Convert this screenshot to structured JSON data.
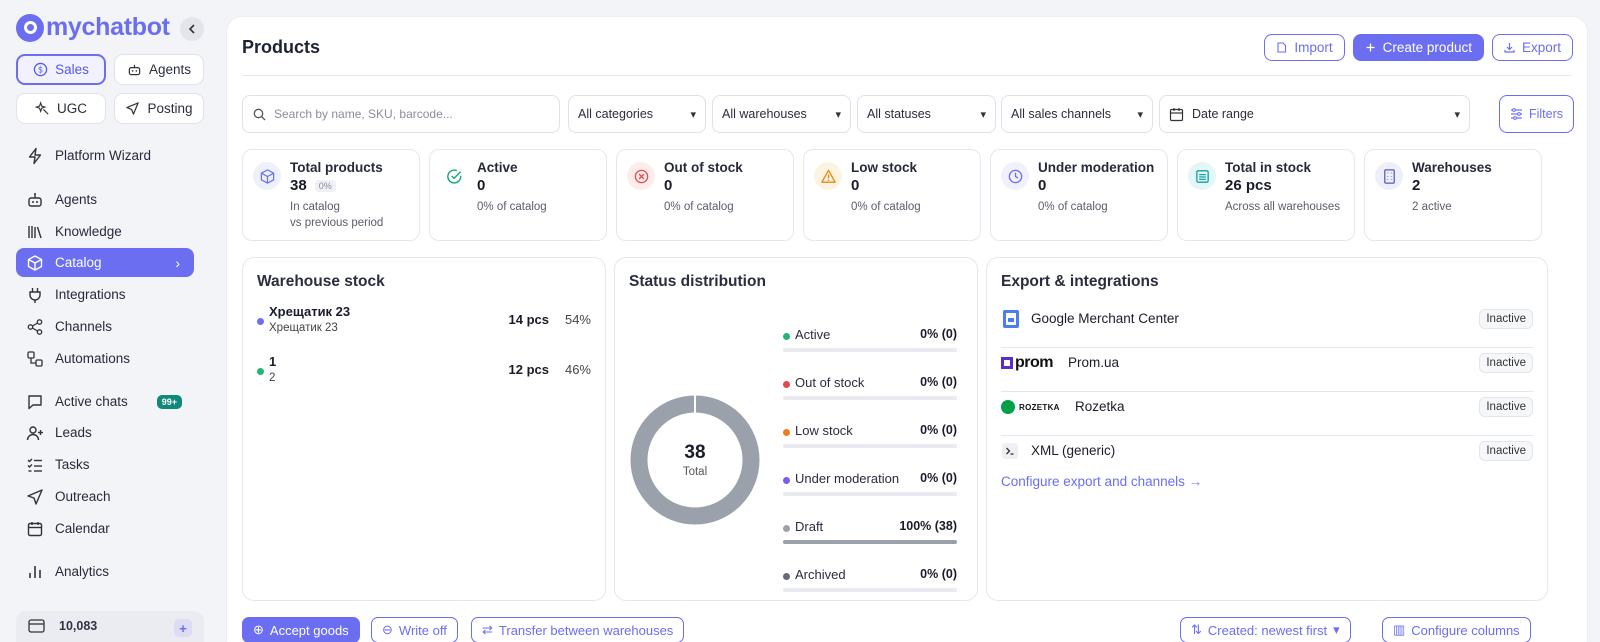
{
  "brand": {
    "name": "mychatbot",
    "accent": "#6b6ef0"
  },
  "sidebar": {
    "modes": [
      {
        "label": "Sales",
        "icon": "dollar-icon",
        "active": true
      },
      {
        "label": "Agents",
        "icon": "robot-icon",
        "active": false
      },
      {
        "label": "UGC",
        "icon": "sparkle-icon",
        "active": false
      },
      {
        "label": "Posting",
        "icon": "send-icon",
        "active": false
      }
    ],
    "items": [
      {
        "label": "Platform Wizard",
        "icon": "bolt-icon"
      },
      {
        "label": "Agents",
        "icon": "robot-icon"
      },
      {
        "label": "Knowledge",
        "icon": "library-icon"
      },
      {
        "label": "Catalog",
        "icon": "box-icon",
        "active": true
      },
      {
        "label": "Integrations",
        "icon": "plug-icon"
      },
      {
        "label": "Channels",
        "icon": "share-icon"
      },
      {
        "label": "Automations",
        "icon": "workflow-icon"
      },
      {
        "label": "Active chats",
        "icon": "chat-icon",
        "badge": "99+"
      },
      {
        "label": "Leads",
        "icon": "user-plus-icon"
      },
      {
        "label": "Tasks",
        "icon": "tasks-icon"
      },
      {
        "label": "Outreach",
        "icon": "send-icon"
      },
      {
        "label": "Calendar",
        "icon": "calendar-icon"
      },
      {
        "label": "Analytics",
        "icon": "bar-chart-icon"
      }
    ],
    "balance": "10,083"
  },
  "header": {
    "title": "Products",
    "import_label": "Import",
    "create_label": "Create product",
    "export_label": "Export"
  },
  "filters": {
    "search_placeholder": "Search by name, SKU, barcode...",
    "categories": "All categories",
    "warehouses": "All warehouses",
    "statuses": "All statuses",
    "channels": "All sales channels",
    "date": "Date range",
    "filters_label": "Filters"
  },
  "stats": [
    {
      "label": "Total products",
      "value": "38",
      "pct": "0%",
      "sub1": "In catalog",
      "sub2": "vs previous period",
      "icon": "box-icon",
      "color": "#6b6ef0",
      "bg": "#eef0fb"
    },
    {
      "label": "Active",
      "value": "0",
      "sub1": "0% of catalog",
      "icon": "check-circle-icon",
      "color": "#17a673",
      "bg": "#ffffff"
    },
    {
      "label": "Out of stock",
      "value": "0",
      "sub1": "0% of catalog",
      "icon": "x-circle-icon",
      "color": "#e5484d",
      "bg": "#fdecec"
    },
    {
      "label": "Low stock",
      "value": "0",
      "sub1": "0% of catalog",
      "icon": "warning-icon",
      "color": "#e8890c",
      "bg": "#fdf3e3"
    },
    {
      "label": "Under moderation",
      "value": "0",
      "sub1": "0% of catalog",
      "icon": "clock-icon",
      "color": "#6b6ef0",
      "bg": "#f0f1fb"
    },
    {
      "label": "Total in stock",
      "value": "26 pcs",
      "sub1": "Across all warehouses",
      "icon": "stack-icon",
      "color": "#0fa3a3",
      "bg": "#e4f6f5"
    },
    {
      "label": "Warehouses",
      "value": "2",
      "sub1": "2 active",
      "icon": "building-icon",
      "color": "#5558c8",
      "bg": "#eeeff8"
    }
  ],
  "warehouse_stock": {
    "title": "Warehouse stock",
    "rows": [
      {
        "name": "Хрещатик 23",
        "sub": "Хрещатик 23",
        "qty": "14 pcs",
        "pct": "54%",
        "color": "#6b6ef0"
      },
      {
        "name": "1",
        "sub": "2",
        "qty": "12 pcs",
        "pct": "46%",
        "color": "#22b573"
      }
    ]
  },
  "status_distribution": {
    "title": "Status distribution",
    "total": "38",
    "total_label": "Total",
    "rows": [
      {
        "name": "Active",
        "value": "0% (0)",
        "fraction": 0,
        "color": "#22b573"
      },
      {
        "name": "Out of stock",
        "value": "0% (0)",
        "fraction": 0,
        "color": "#e5484d"
      },
      {
        "name": "Low stock",
        "value": "0% (0)",
        "fraction": 0,
        "color": "#f07c1c"
      },
      {
        "name": "Under moderation",
        "value": "0% (0)",
        "fraction": 0,
        "color": "#7b5cf0"
      },
      {
        "name": "Draft",
        "value": "100% (38)",
        "fraction": 1,
        "color": "#9ba1ab"
      },
      {
        "name": "Archived",
        "value": "0% (0)",
        "fraction": 0,
        "color": "#666a78"
      }
    ]
  },
  "integrations": {
    "title": "Export & integrations",
    "rows": [
      {
        "name": "Google Merchant Center",
        "status": "Inactive",
        "logo": "google-merchant-icon"
      },
      {
        "name": "Prom.ua",
        "status": "Inactive",
        "logo": "prom-logo",
        "logo_text": "prom"
      },
      {
        "name": "Rozetka",
        "status": "Inactive",
        "logo": "rozetka-logo",
        "logo_text": "ROZETKA"
      },
      {
        "name": "XML (generic)",
        "status": "Inactive",
        "logo": "terminal-icon"
      }
    ],
    "configure_link": "Configure export and channels"
  },
  "bottom_actions": {
    "accept": "Accept goods",
    "writeoff": "Write off",
    "transfer": "Transfer between warehouses",
    "sort": "Created: newest first",
    "columns": "Configure columns"
  }
}
